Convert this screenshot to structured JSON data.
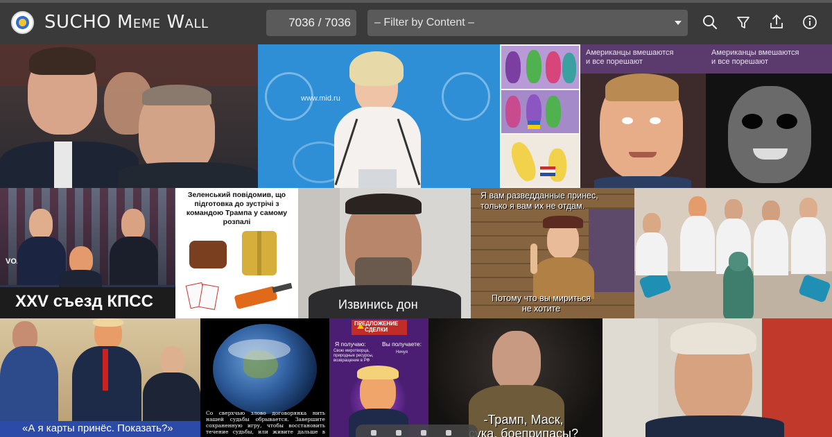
{
  "header": {
    "title_prefix": "SUCHO ",
    "title_sc": "Meme Wall",
    "counter": "7036 / 7036",
    "filter_placeholder": "– Filter by Content –"
  },
  "icons": [
    "search-icon",
    "filter-icon",
    "share-icon",
    "info-icon"
  ],
  "tiles": {
    "rus_memes_top": "Американцы вмешаются\nи все порешают",
    "mid_site": "www.mid.ru",
    "xxv": "XXV съезд КПСС",
    "voa": "VOA",
    "zelensky": "Зеленський повідомив, що\nпідготовка до зустрічі з\nкомандою Трампа у самому\nрозпалі",
    "kadyrov_cap": "Извинись дон",
    "scout_top": "Я вам разведданные принес,\nтолько я вам их не отдам.",
    "scout_bottom": "Потому что вы мириться\nне хотите",
    "cards": "«А я карты принёс. Показать?»",
    "earth_text": "Со сверхчью злово договорянка нить нашей судьбы обрывается. Завершите сохраненную игру, чтобы восстановить течение судьбы, или живите дальше в проклятом мире.",
    "deal_title": "ПРЕДЛОЖЕНИЕ\nСДЕЛКИ",
    "deal_left": "Я получаю:",
    "deal_right": "Вы получаете:",
    "deal_left_text": "Свою миротворца, природные ресурсы, возвращение в РФ",
    "deal_right_text": "Ничуя",
    "prig_cap": "-Трамп, Маск,\nсука, боеприпасы?"
  }
}
